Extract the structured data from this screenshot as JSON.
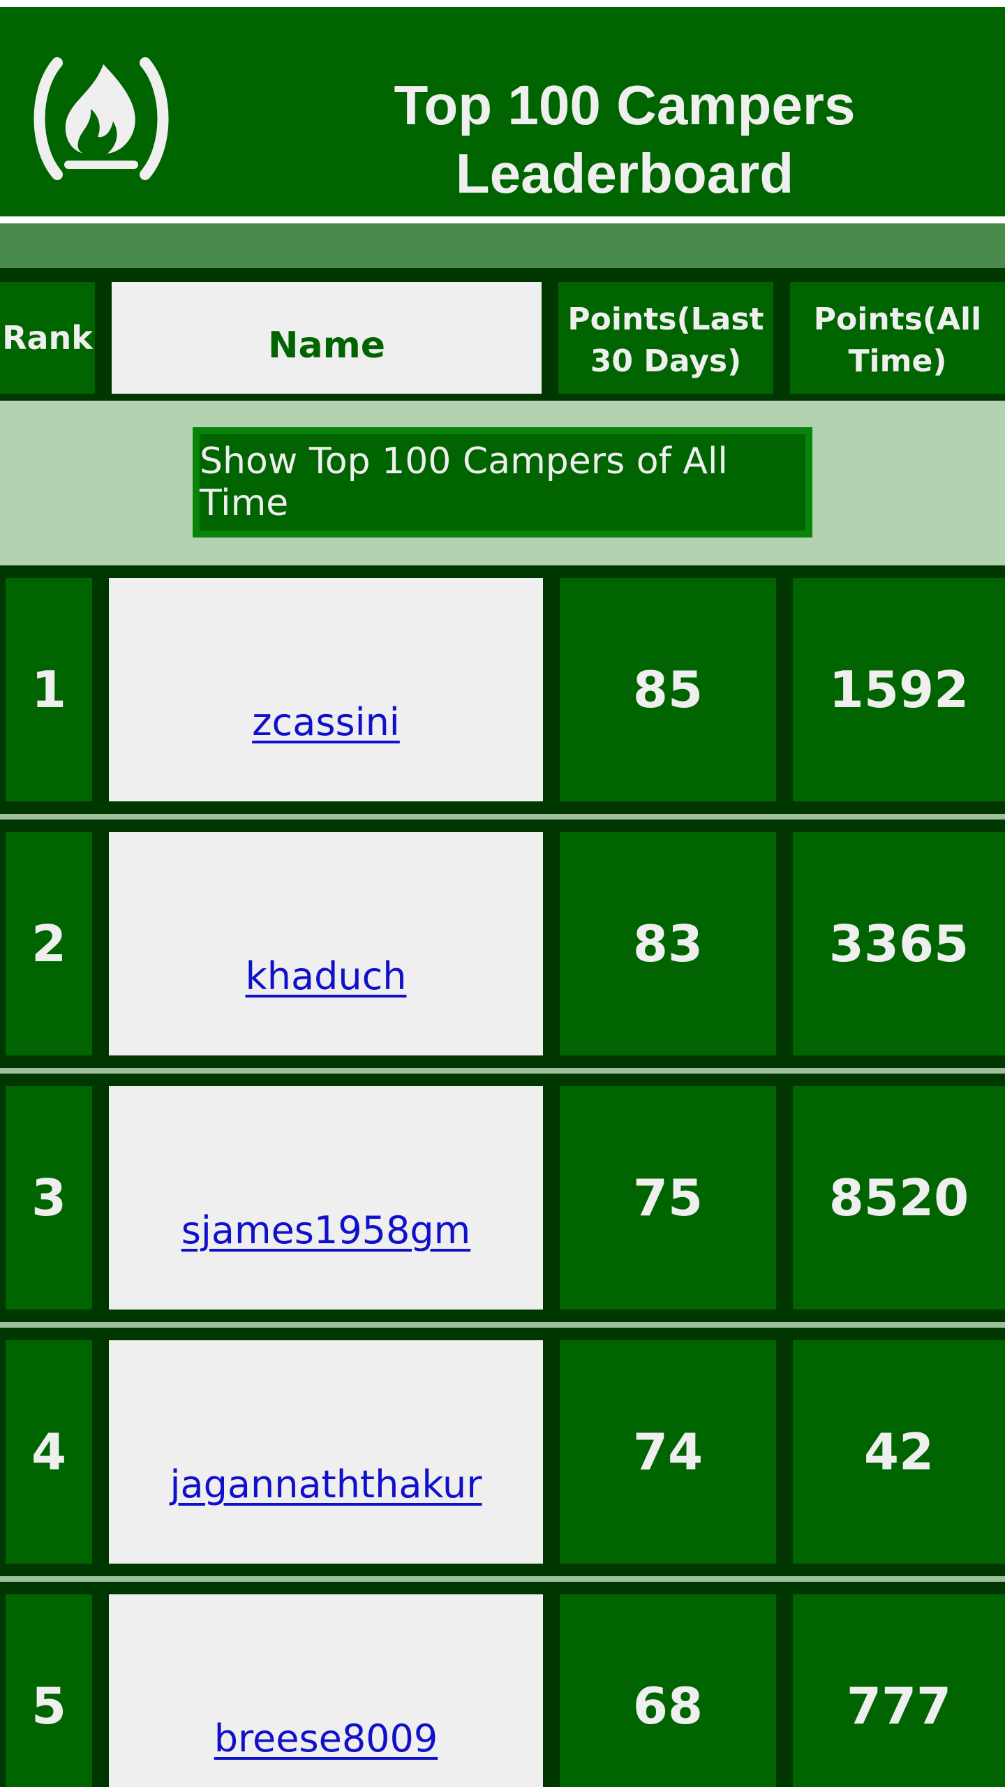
{
  "header": {
    "title_line1": "Top 100 Campers",
    "title_line2": "Leaderboard",
    "logo_icon": "freecodecamp-flame-icon"
  },
  "columns": {
    "rank": "Rank",
    "name": "Name",
    "points_30": "Points(Last 30 Days)",
    "points_all": "Points(All Time)"
  },
  "toggle": {
    "label": "Show Top 100 Campers of All Time"
  },
  "rows": [
    {
      "rank": "1",
      "name": "zcassini",
      "points_30": "85",
      "points_all": "1592"
    },
    {
      "rank": "2",
      "name": "khaduch",
      "points_30": "83",
      "points_all": "3365"
    },
    {
      "rank": "3",
      "name": "sjames1958gm",
      "points_30": "75",
      "points_all": "8520"
    },
    {
      "rank": "4",
      "name": "jagannaththakur",
      "points_30": "74",
      "points_all": "42"
    },
    {
      "rank": "5",
      "name": "breese8009",
      "points_30": "68",
      "points_all": "777"
    }
  ],
  "colors": {
    "primary_green": "#006400",
    "dark_green": "#003600",
    "light_green": "#b2d2b2",
    "text_light": "#efefef",
    "link_blue": "#1010cc"
  }
}
